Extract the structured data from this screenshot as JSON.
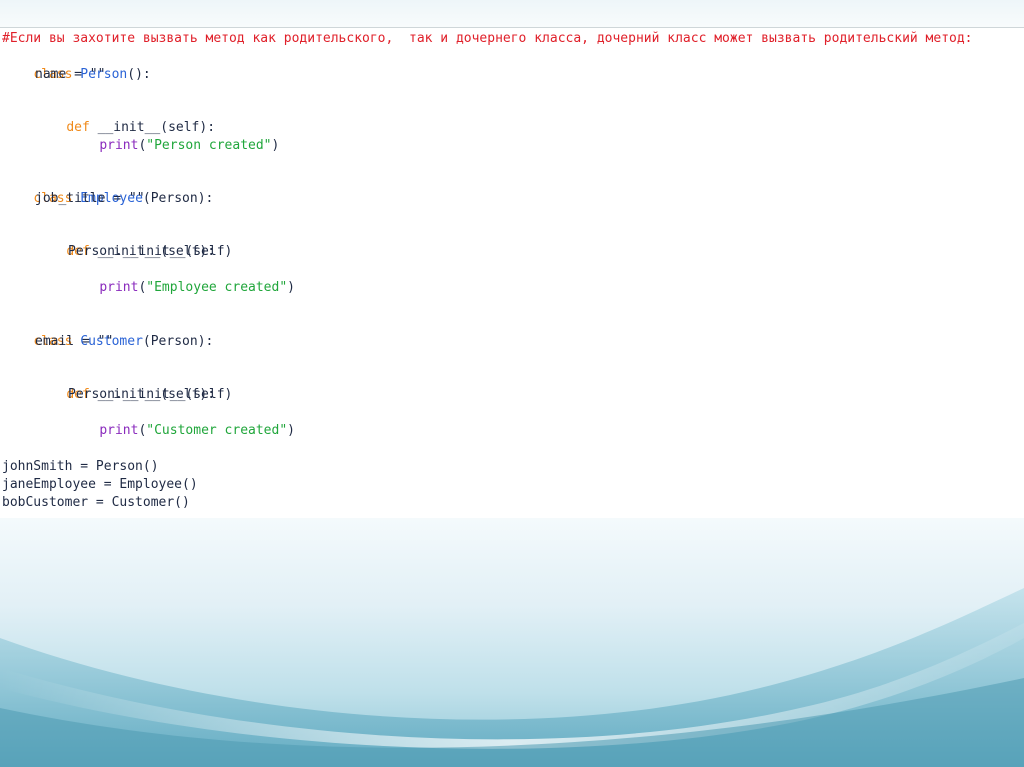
{
  "code": {
    "comment": "#Если вы захотите вызвать метод как родительского,  так и дочернего класса, дочерний класс может вызвать родительский метод:",
    "kw_class": "class",
    "kw_def": "def",
    "person_class": "Person",
    "person_suffix": "():",
    "name_line": "name = \"\"",
    "init_sig": "__init__(self):",
    "print_fn": "print",
    "open_paren": "(",
    "close_paren": ")",
    "str_person": "\"Person created\"",
    "employee_class": "Employee",
    "parent_arg": "(Person):",
    "job_title_line": "job_title = \"\"",
    "super_call": "Person.__init__(self)",
    "str_employee": "\"Employee created\"",
    "customer_class": "Customer",
    "email_line": "email = \"\"",
    "str_customer": "\"Customer created\"",
    "inst_john": "johnSmith = Person()",
    "inst_jane": "janeEmployee = Employee()",
    "inst_bob": "bobCustomer = Customer()"
  },
  "colors": {
    "comment": "#e0202a",
    "keyword": "#f08a1a",
    "class_name": "#2a63d6",
    "builtin": "#8a2bbd",
    "string": "#20a63b",
    "text": "#1f2a44"
  }
}
